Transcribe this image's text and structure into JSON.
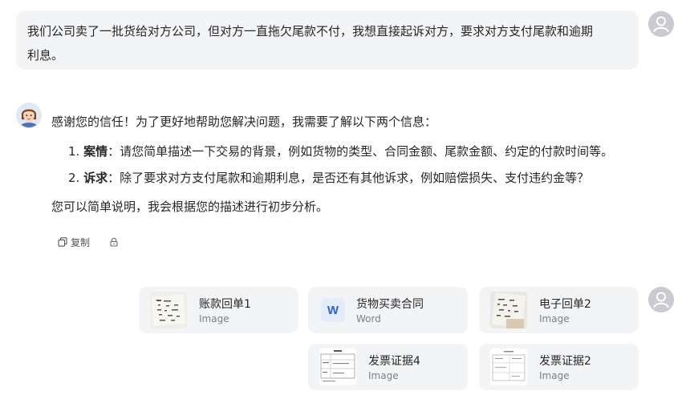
{
  "user_message": {
    "line1": "我们公司卖了一批货给对方公司，但对方一直拖欠尾款不付，我想直接起诉对方，要求对方支付尾款和逾期",
    "line2": "利息。"
  },
  "assistant_message": {
    "intro": "感谢您的信任！为了更好地帮助您解决问题，我需要了解以下两个信息：",
    "items": [
      {
        "num": "1.",
        "title": "案情",
        "sep": "：",
        "text": "请您简单描述一下交易的背景，例如货物的类型、合同金额、尾款金额、约定的付款时间等。"
      },
      {
        "num": "2.",
        "title": "诉求",
        "sep": "：",
        "text": "除了要求对方支付尾款和逾期利息，是否还有其他诉求，例如赔偿损失、支付违约金等？"
      }
    ],
    "closing": "您可以简单说明，我会根据您的描述进行初步分析。",
    "actions": {
      "copy_label": "复制"
    }
  },
  "attachments": [
    {
      "name": "账款回单1",
      "type": "Image",
      "kind": "image",
      "icon": "receipt-thumbnail"
    },
    {
      "name": "货物买卖合同",
      "type": "Word",
      "kind": "word",
      "icon": "word-doc-icon",
      "icon_letter": "W"
    },
    {
      "name": "电子回单2",
      "type": "Image",
      "kind": "image",
      "icon": "receipt-thumbnail"
    },
    {
      "name": "发票证据4",
      "type": "Image",
      "kind": "image",
      "icon": "invoice-thumbnail"
    },
    {
      "name": "发票证据2",
      "type": "Image",
      "kind": "image",
      "icon": "invoice-thumbnail"
    }
  ],
  "colors": {
    "bubble_bg": "#f3f4f6",
    "word_blue": "#2b62d6",
    "user_avatar_bg": "#c9cbd0"
  }
}
